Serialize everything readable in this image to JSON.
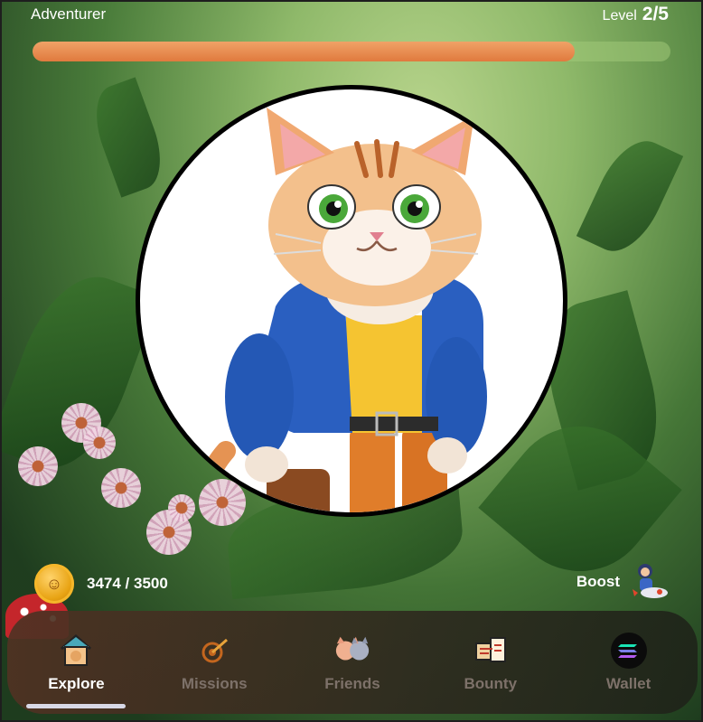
{
  "header": {
    "title": "Adventurer",
    "level_label": "Level",
    "level_value": "2/5",
    "progress_fraction": 0.85
  },
  "character": {
    "icon": "cat-character-image"
  },
  "stats": {
    "coin_icon": "coin-icon",
    "balance": "3474 / 3500",
    "boost_label": "Boost",
    "boost_icon": "astronaut-rocket-icon"
  },
  "nav": {
    "items": [
      {
        "label": "Explore",
        "icon": "house-icon",
        "active": true
      },
      {
        "label": "Missions",
        "icon": "target-icon",
        "active": false
      },
      {
        "label": "Friends",
        "icon": "friends-icon",
        "active": false
      },
      {
        "label": "Bounty",
        "icon": "bounty-icon",
        "active": false
      },
      {
        "label": "Wallet",
        "icon": "wallet-icon",
        "active": false
      }
    ]
  },
  "colors": {
    "progress_fill": "#e07a3e",
    "active_label": "#ffffff",
    "inactive_label": "#7d7169"
  }
}
